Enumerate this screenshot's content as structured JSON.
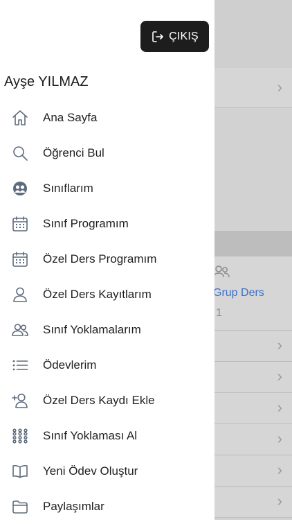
{
  "drawer": {
    "logout_label": "ÇIKIŞ",
    "user_name": "Ayşe YILMAZ",
    "items": [
      {
        "label": "Ana Sayfa",
        "icon": "home-icon"
      },
      {
        "label": "Öğrenci Bul",
        "icon": "search-icon"
      },
      {
        "label": "Sınıflarım",
        "icon": "group-icon"
      },
      {
        "label": "Sınıf Programım",
        "icon": "calendar-icon"
      },
      {
        "label": "Özel Ders Programım",
        "icon": "calendar-icon"
      },
      {
        "label": "Özel Ders Kayıtlarım",
        "icon": "user-icon"
      },
      {
        "label": "Sınıf Yoklamalarım",
        "icon": "users-icon"
      },
      {
        "label": "Ödevlerim",
        "icon": "list-icon"
      },
      {
        "label": "Özel Ders Kaydı Ekle",
        "icon": "add-user-icon"
      },
      {
        "label": "Sınıf Yoklaması Al",
        "icon": "grid-dots-icon"
      },
      {
        "label": "Yeni Ödev Oluştur",
        "icon": "book-icon"
      },
      {
        "label": "Paylaşımlar",
        "icon": "folder-icon"
      }
    ]
  },
  "background": {
    "grup_label": "Grup Ders",
    "grup_count": "1"
  },
  "colors": {
    "logout_bg": "#1d1d1d",
    "icon_stroke": "#5d6b7d",
    "link_blue": "#3b6fc9",
    "backdrop": "#d2d2d2"
  }
}
